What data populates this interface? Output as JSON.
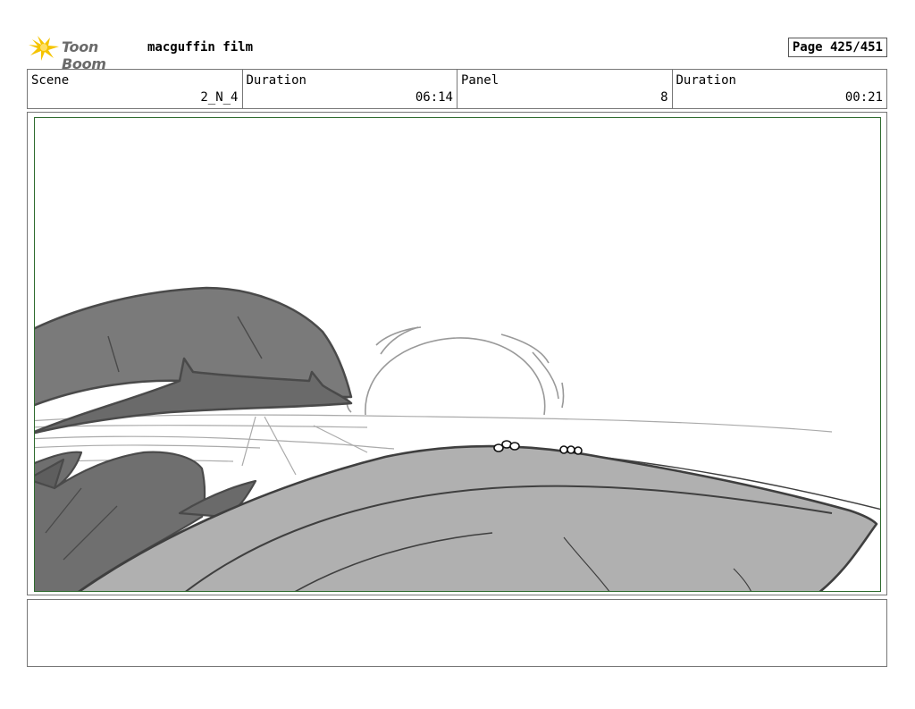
{
  "header": {
    "brand": "Toon Boom",
    "project": "macguffin film",
    "page": "Page 425/451"
  },
  "info": {
    "scene_label": "Scene",
    "scene_value": "2_N_4",
    "duration_label": "Duration",
    "duration_value": "06:14",
    "panel_label": "Panel",
    "panel_value": "8",
    "panel_duration_label": "Duration",
    "panel_duration_value": "00:21"
  },
  "colors": {
    "frame_border": "#2e6b2e",
    "rock_dark": "#6e6e6e",
    "rock_mid": "#8a8a8a",
    "rock_light": "#b0b0b0",
    "logo_yellow": "#f5c400"
  },
  "notes": {
    "text": ""
  }
}
